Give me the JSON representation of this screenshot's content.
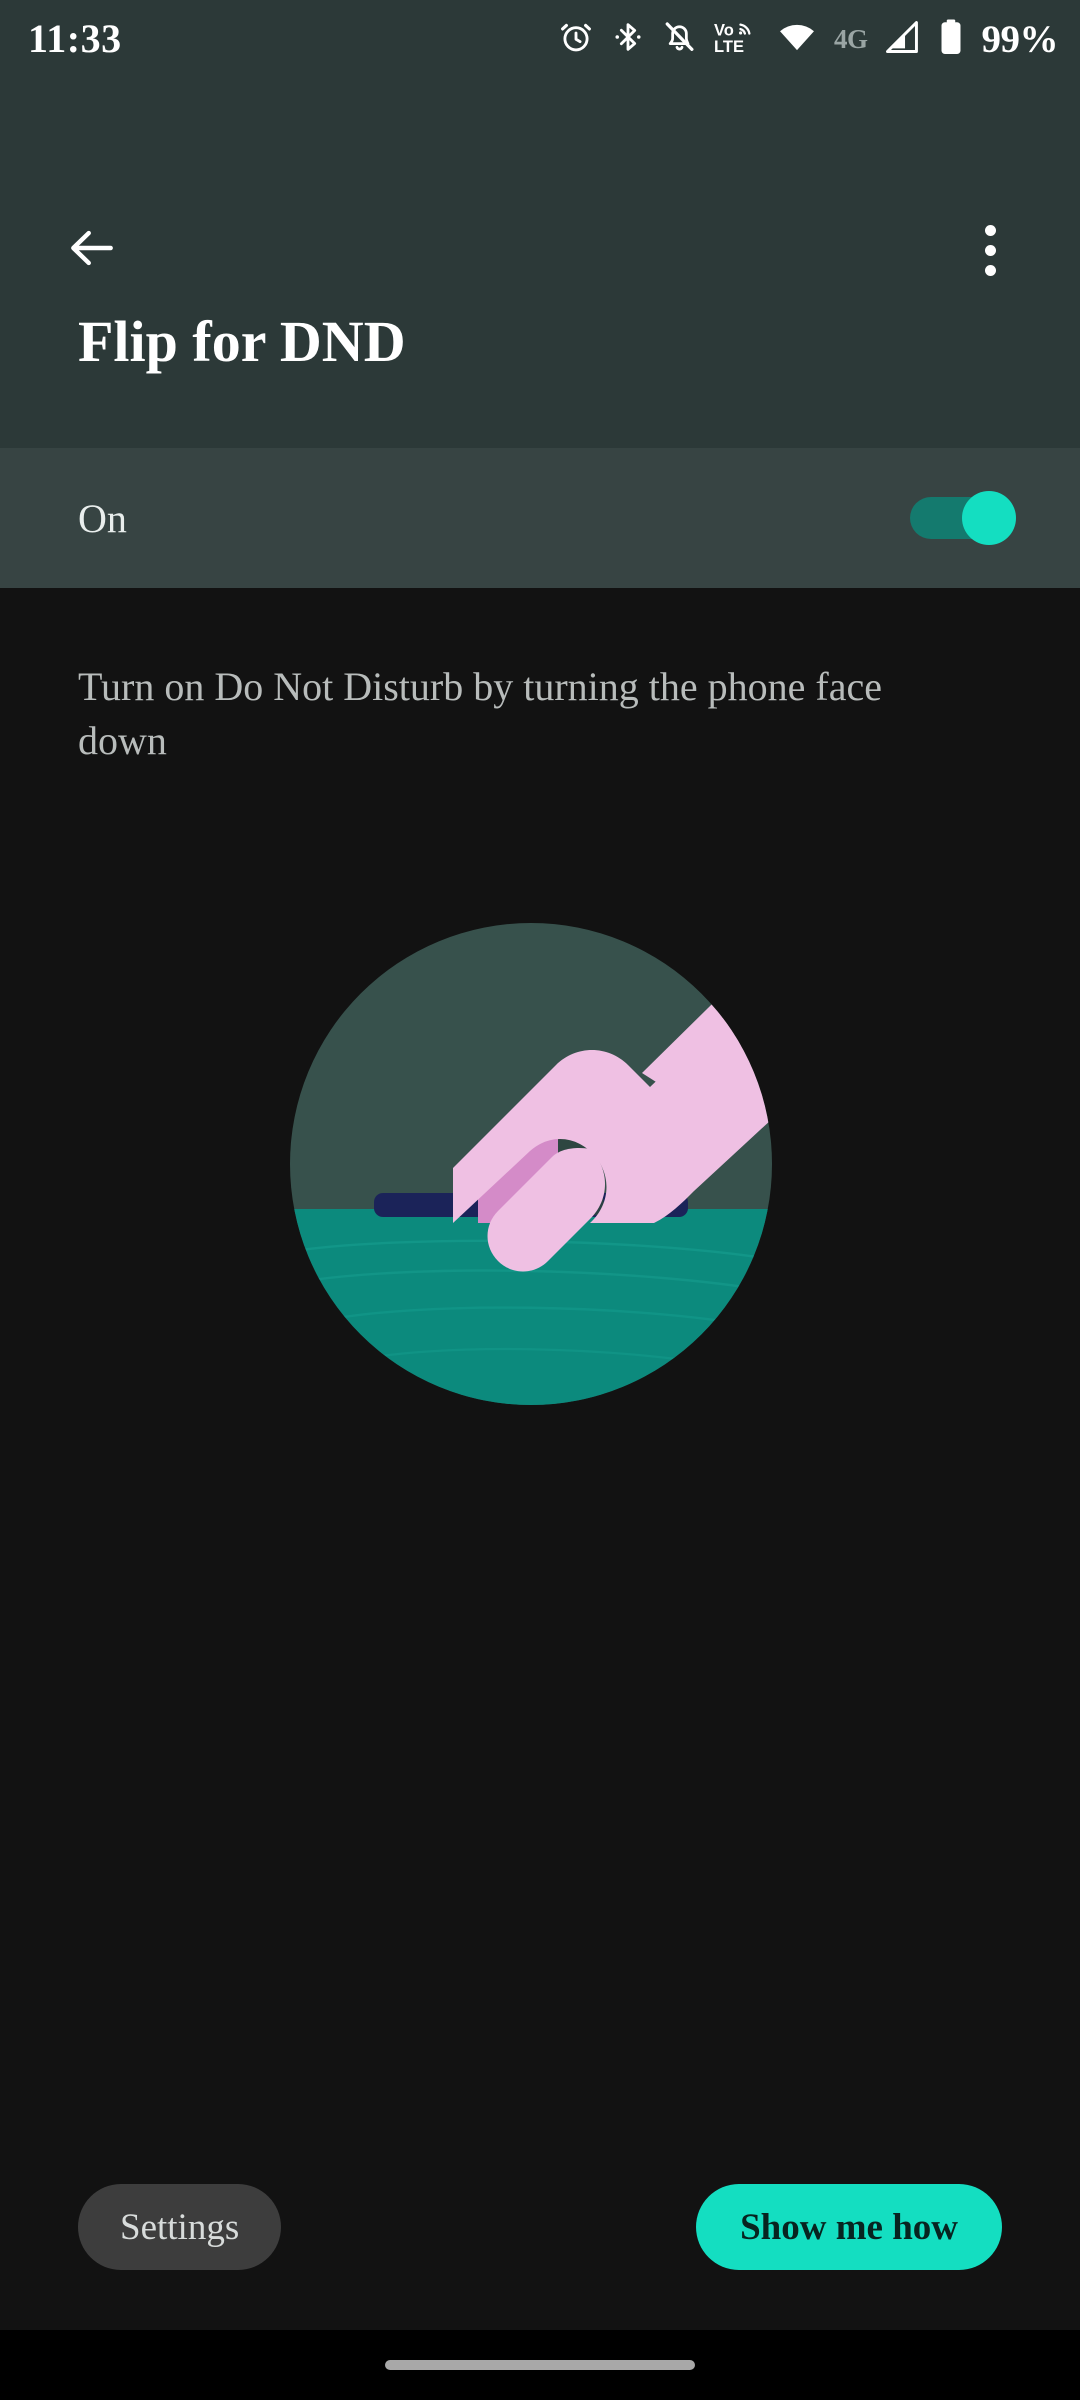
{
  "status_bar": {
    "time": "11:33",
    "battery_percent": "99%",
    "network_label": "4G",
    "icons": [
      "alarm-icon",
      "bluetooth-icon",
      "notifications-silenced-icon",
      "volte-icon",
      "wifi-icon",
      "mobile-signal-icon",
      "battery-icon"
    ]
  },
  "app_bar": {
    "title": "Flip for DND",
    "back_icon": "back-arrow-icon",
    "overflow_icon": "overflow-menu-icon"
  },
  "toggle_row": {
    "label": "On",
    "checked": true
  },
  "content": {
    "description": "Turn on Do Not Disturb by turning the phone face down",
    "illustration_name": "hand-placing-phone-face-down-illustration"
  },
  "buttons": {
    "settings": "Settings",
    "show_me_how": "Show me how"
  },
  "nav_bar": {
    "pill": "gesture-home-pill"
  },
  "colors": {
    "header_bg": "#2c3938",
    "toggle_row_bg": "#374443",
    "content_bg": "#121212",
    "accent": "#14dec1",
    "track": "#147a6e",
    "settings_bg": "#3d3d3d",
    "illus_circle": "#37514c",
    "illus_table": "#0c8a7d",
    "illus_phone": "#1b2359",
    "illus_hand": "#efc0e3",
    "illus_hand_shadow": "#d48bc8"
  }
}
